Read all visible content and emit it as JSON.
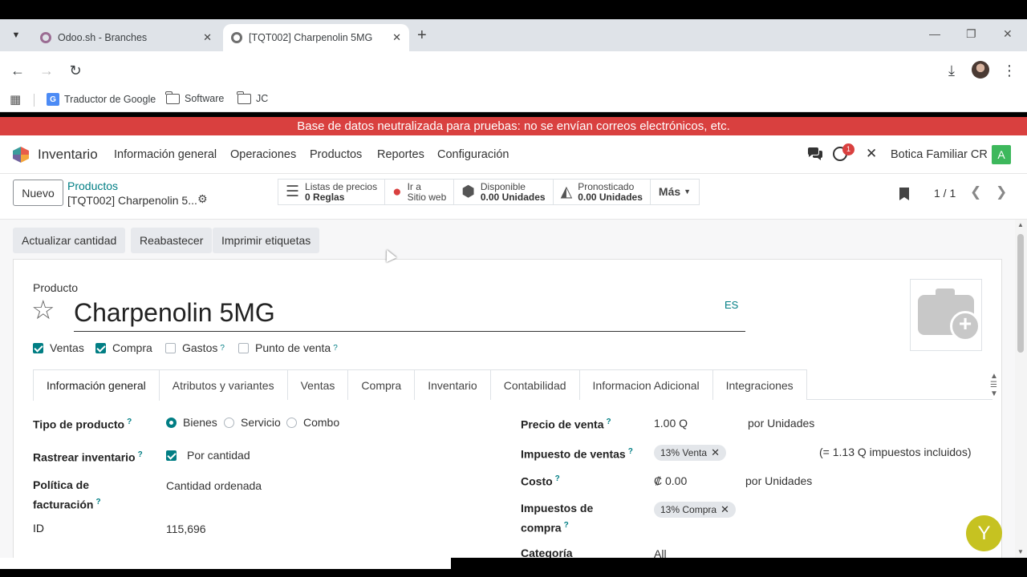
{
  "browser": {
    "tabs": [
      {
        "title": "Odoo.sh - Branches"
      },
      {
        "title": "[TQT002] Charpenolin 5MG"
      }
    ],
    "bookmarks": [
      "Traductor de Google",
      "Software",
      "JC"
    ]
  },
  "banner": "Base de datos neutralizada para pruebas: no se envían correos electrónicos, etc.",
  "nav": {
    "app": "Inventario",
    "menus": [
      "Información general",
      "Operaciones",
      "Productos",
      "Reportes",
      "Configuración"
    ],
    "notification_count": "1",
    "company": "Botica Familiar CR",
    "user_initial": "A"
  },
  "control": {
    "new_label": "Nuevo",
    "breadcrumb_parent": "Productos",
    "breadcrumb_current": "[TQT002] Charpenolin 5...",
    "stats": [
      {
        "line1": "Listas de precios",
        "line2": "0 Reglas"
      },
      {
        "line1": "Ir a",
        "line2": "Sitio web"
      },
      {
        "line1": "Disponible",
        "line2": "0.00 Unidades"
      },
      {
        "line1": "Pronosticado",
        "line2": "0.00 Unidades"
      }
    ],
    "more_label": "Más",
    "pager": "1 / 1"
  },
  "actions": [
    "Actualizar cantidad",
    "Reabastecer",
    "Imprimir etiquetas"
  ],
  "form": {
    "product_label": "Producto",
    "product_name": "Charpenolin 5MG",
    "lang": "ES",
    "checkboxes": [
      {
        "label": "Ventas",
        "checked": true
      },
      {
        "label": "Compra",
        "checked": true
      },
      {
        "label": "Gastos",
        "checked": false,
        "help": "?"
      },
      {
        "label": "Punto de venta",
        "checked": false,
        "help": "?"
      }
    ],
    "tabs": [
      "Información general",
      "Atributos y variantes",
      "Ventas",
      "Compra",
      "Inventario",
      "Contabilidad",
      "Informacion Adicional",
      "Integraciones"
    ],
    "left": {
      "product_type_label": "Tipo de producto",
      "product_type_options": [
        "Bienes",
        "Servicio",
        "Combo"
      ],
      "track_label": "Rastrear inventario",
      "track_value": "Por cantidad",
      "invoice_policy_label_1": "Política de",
      "invoice_policy_label_2": "facturación",
      "invoice_policy_value": "Cantidad ordenada",
      "id_label": "ID",
      "id_value": "115,696"
    },
    "right": {
      "sale_price_label": "Precio de venta",
      "sale_price": "1.00 Q",
      "sale_price_uom": "por Unidades",
      "sale_tax_label": "Impuesto de ventas",
      "sale_tax_tag": "13% Venta",
      "sale_tax_note": "(= 1.13 Q impuestos incluidos)",
      "cost_label": "Costo",
      "cost_value": "₡ 0.00",
      "cost_uom": "por Unidades",
      "purchase_tax_label_1": "Impuestos de",
      "purchase_tax_label_2": "compra",
      "purchase_tax_tag": "13% Compra",
      "category_label": "Categoría",
      "category_value": "All"
    }
  },
  "chatbot_initial": "Y"
}
